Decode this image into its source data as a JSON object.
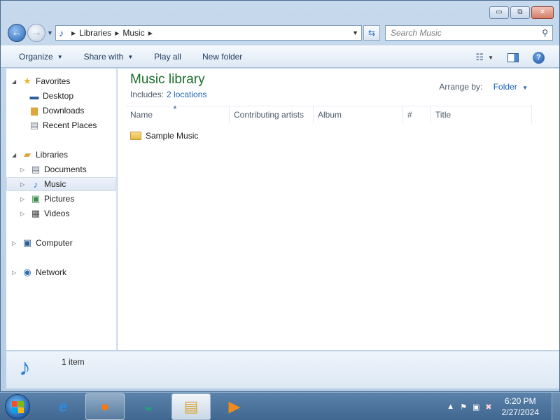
{
  "window": {
    "minimize_glyph": "▭",
    "maximize_glyph": "⧉",
    "close_glyph": "✕"
  },
  "navbar": {
    "back_glyph": "←",
    "forward_glyph": "→",
    "breadcrumbs": [
      "Libraries",
      "Music"
    ],
    "search": {
      "placeholder": "Search Music"
    }
  },
  "toolbar": {
    "organize": "Organize",
    "share_with": "Share with",
    "play_all": "Play all",
    "new_folder": "New folder"
  },
  "nav_pane": {
    "favorites": {
      "label": "Favorites",
      "items": [
        "Desktop",
        "Downloads",
        "Recent Places"
      ]
    },
    "libraries": {
      "label": "Libraries",
      "items": [
        "Documents",
        "Music",
        "Pictures",
        "Videos"
      ]
    },
    "computer": "Computer",
    "network": "Network",
    "selected": "Music"
  },
  "content": {
    "title": "Music library",
    "includes_label": "Includes:",
    "includes_link": "2 locations",
    "arrange_label": "Arrange by:",
    "arrange_value": "Folder",
    "columns": [
      "Name",
      "Contributing artists",
      "Album",
      "#",
      "Title"
    ],
    "items": [
      {
        "name": "Sample Music",
        "type": "folder"
      }
    ]
  },
  "details": {
    "count": "1 item"
  },
  "taskbar": {
    "time": "6:20 PM",
    "date": "2/27/2024",
    "pinned": [
      "internet-explorer-icon",
      "firefox-icon",
      "edge-icon",
      "windows-explorer-icon",
      "media-player-icon"
    ]
  },
  "colors": {
    "library_title": "#1a6d29",
    "link": "#1a64b5",
    "taskbar": "#4a739c"
  }
}
